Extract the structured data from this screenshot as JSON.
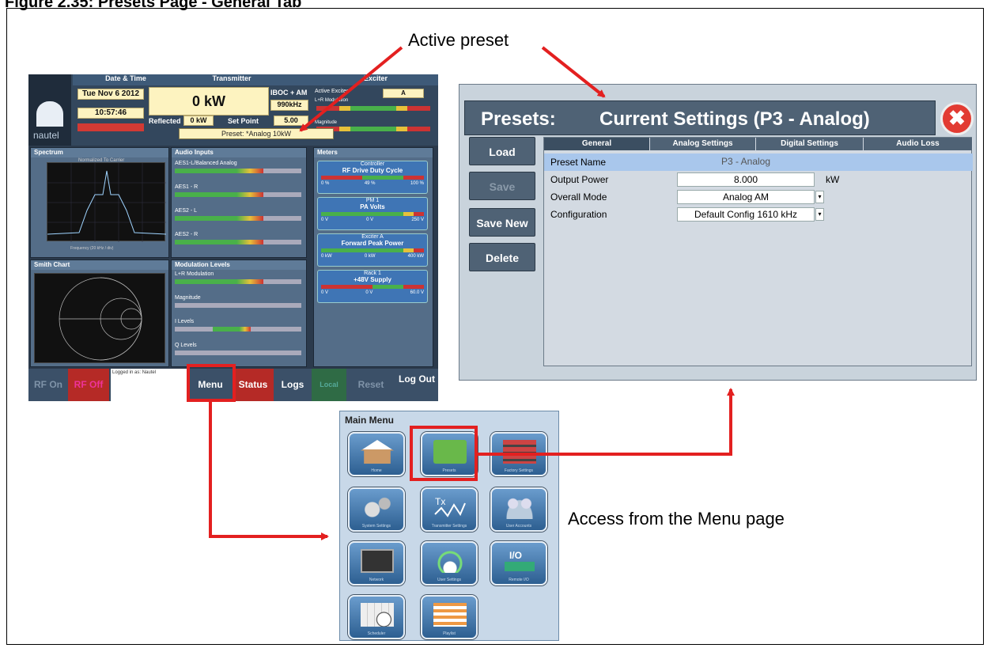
{
  "figure": {
    "title": "Figure 2.35: Presets Page - General Tab"
  },
  "callouts": {
    "active_preset": "Active preset",
    "access_menu": "Access from the Menu page"
  },
  "main_screen": {
    "logo_text": "nautel",
    "header": {
      "date_time_label": "Date & Time",
      "date": "Tue Nov 6 2012",
      "time": "10:57:46",
      "transmitter_label": "Transmitter",
      "power": "0 kW",
      "mode": "IBOC + AM",
      "frequency": "990kHz",
      "reflected_label": "Reflected",
      "reflected_value": "0 kW",
      "setpoint_label": "Set Point",
      "setpoint_value": "5.00",
      "exciter_label": "Exciter",
      "active_exciter_label": "Active Exciter",
      "active_exciter": "A",
      "lr_mod_label": "L+R Modulation",
      "magnitude_label": "Magnitude",
      "preset": "Preset: *Analog 10kW"
    },
    "spectrum": {
      "title": "Spectrum",
      "plot_title": "Normalized To Carrier",
      "legend": "Carrier Freq\n990.0 kHz",
      "xlabel": "Frequency (20 kHz / div)"
    },
    "smith": {
      "title": "Smith Chart",
      "zoom": "Zoom 200%"
    },
    "audio_inputs": {
      "title": "Audio Inputs",
      "rows": [
        "AES1-L/Balanced Analog",
        "AES1 - R",
        "AES2 - L",
        "AES2 - R"
      ]
    },
    "modulation": {
      "title": "Modulation Levels",
      "rows": [
        "L+R Modulation",
        "Magnitude",
        "I Levels",
        "Q Levels"
      ]
    },
    "meters": {
      "title": "Meters",
      "cards": [
        {
          "source": "Controller",
          "name": "RF Drive Duty Cycle",
          "min": "0 %",
          "value": "49 %",
          "max": "100 %"
        },
        {
          "source": "PM 1",
          "name": "PA Volts",
          "min": "0 V",
          "value": "0 V",
          "max": "250 V"
        },
        {
          "source": "Exciter A",
          "name": "Forward Peak Power",
          "min": "0 kW",
          "value": "0 kW",
          "max": "400 kW"
        },
        {
          "source": "Rack 1",
          "name": "+48V Supply",
          "min": "0 V",
          "value": "0 V",
          "max": "60.0 V"
        }
      ]
    },
    "footer": {
      "rf_on": "RF On",
      "rf_off": "RF Off",
      "logged_in": "Logged in as: Nautel",
      "menu": "Menu",
      "status": "Status",
      "logs": "Logs",
      "local": "Local",
      "reset": "Reset",
      "logout": "Log Out"
    }
  },
  "presets_dialog": {
    "label": "Presets:",
    "current": "Current Settings (P3 - Analog)",
    "close": "✖",
    "buttons": [
      "Load",
      "Save",
      "Save New",
      "Delete"
    ],
    "tabs": [
      "General",
      "Analog Settings",
      "Digital Settings",
      "Audio Loss"
    ],
    "fields": [
      {
        "label": "Preset Name",
        "value": "P3 - Analog"
      },
      {
        "label": "Output Power",
        "value": "8.000",
        "unit": "kW"
      },
      {
        "label": "Overall Mode",
        "value": "Analog AM"
      },
      {
        "label": "Configuration",
        "value": "Default Config 1610 kHz"
      }
    ]
  },
  "main_menu": {
    "title": "Main Menu",
    "items": [
      "Home",
      "Presets",
      "Factory Settings",
      "System Settings",
      "Transmitter Settings",
      "User Accounts",
      "Network",
      "User Settings",
      "Remote I/O",
      "Scheduler",
      "Playlist"
    ]
  },
  "colors": {
    "arrow": "#e32020",
    "dialog_header": "#4f6275",
    "close_button": "#e23b32",
    "highlight_row": "#a9c7ec"
  }
}
